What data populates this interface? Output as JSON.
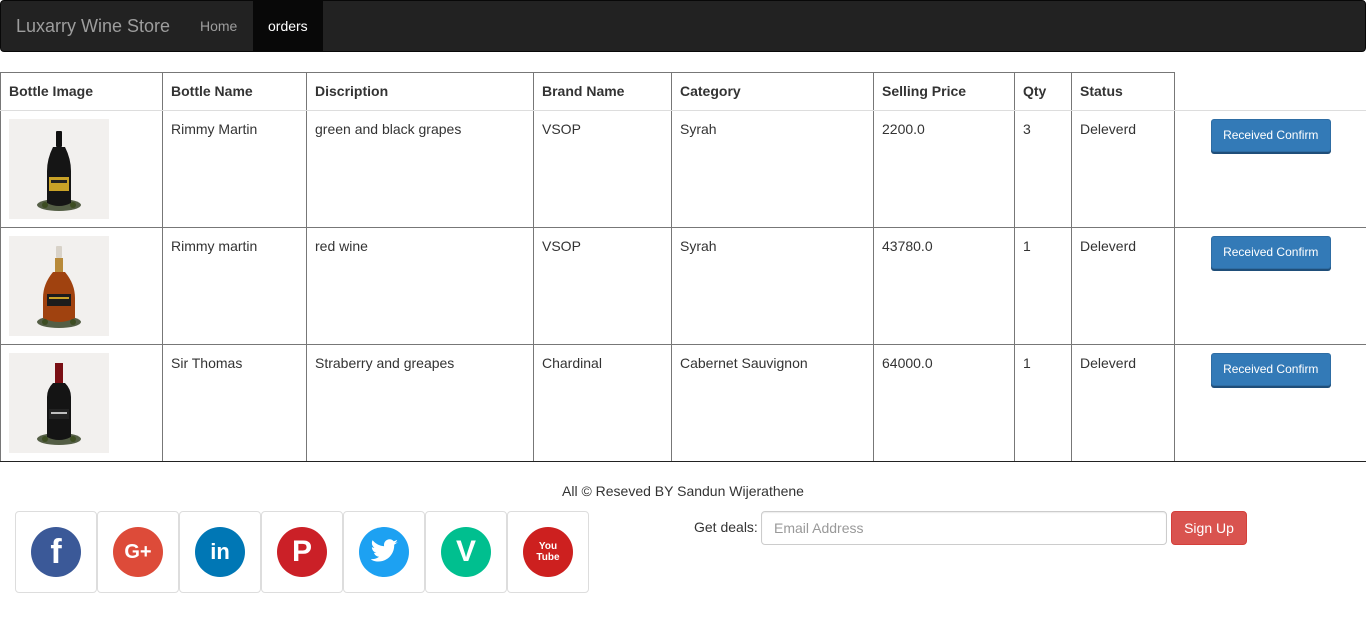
{
  "navbar": {
    "brand": "Luxarry Wine Store",
    "links": [
      {
        "label": "Home",
        "active": false
      },
      {
        "label": "orders",
        "active": true
      }
    ]
  },
  "table": {
    "headers": [
      "Bottle Image",
      "Bottle Name",
      "Discription",
      "Brand Name",
      "Category",
      "Selling Price",
      "Qty",
      "Status",
      ""
    ],
    "rows": [
      {
        "image": "cognac-bottle-black-gold",
        "name": "Rimmy Martin",
        "description": "green and black grapes",
        "brand": "VSOP",
        "category": "Syrah",
        "price": "2200.0",
        "qty": "3",
        "status": "Deleverd",
        "action": "Received Confirm"
      },
      {
        "image": "cognac-bottle-amber",
        "name": "Rimmy martin",
        "description": "red wine",
        "brand": "VSOP",
        "category": "Syrah",
        "price": "43780.0",
        "qty": "1",
        "status": "Deleverd",
        "action": "Received Confirm"
      },
      {
        "image": "wine-bottle-dark-red",
        "name": "Sir Thomas",
        "description": "Straberry and greapes",
        "brand": "Chardinal",
        "category": "Cabernet Sauvignon",
        "price": "64000.0",
        "qty": "1",
        "status": "Deleverd",
        "action": "Received Confirm"
      }
    ]
  },
  "footer": {
    "copyright": "All © Reseved BY Sandun Wijerathene",
    "socials": [
      {
        "name": "facebook-icon",
        "glyph": "f",
        "color": "#3b5998"
      },
      {
        "name": "google-plus-icon",
        "glyph": "G+",
        "color": "#dd4b39"
      },
      {
        "name": "linkedin-icon",
        "glyph": "in",
        "color": "#0077b5"
      },
      {
        "name": "pinterest-icon",
        "glyph": "P",
        "color": "#cb2027"
      },
      {
        "name": "twitter-icon",
        "glyph": "t",
        "color": "#1da1f2"
      },
      {
        "name": "vine-icon",
        "glyph": "V",
        "color": "#00bf8f"
      },
      {
        "name": "youtube-icon",
        "glyph": "You Tube",
        "color": "#cd201f"
      }
    ],
    "deals_label": "Get deals:",
    "email_placeholder": "Email Address",
    "signup_label": "Sign Up"
  },
  "colors": {
    "navbar_bg": "#222222",
    "primary": "#337ab7",
    "danger": "#d9534f"
  }
}
